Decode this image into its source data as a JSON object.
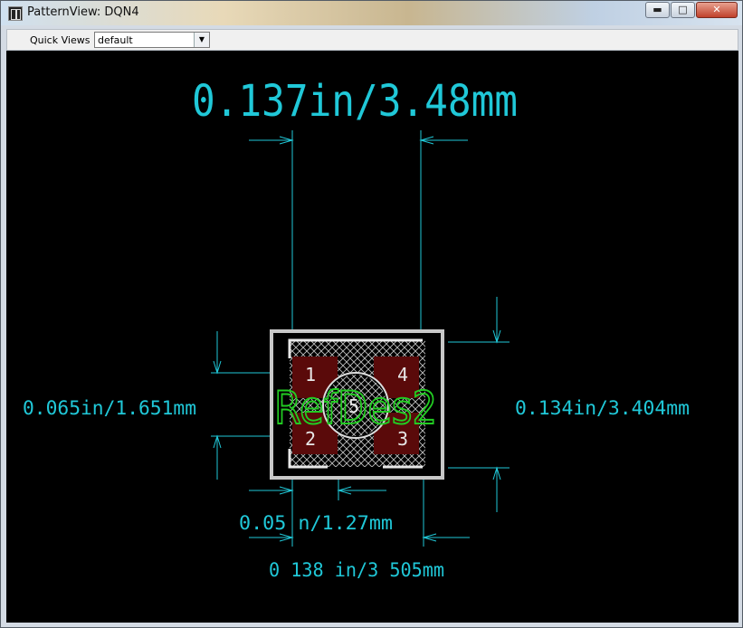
{
  "window": {
    "title": "PatternView: DQN4",
    "minimize": "▬",
    "maximize": "□",
    "close": "✕"
  },
  "toolbar": {
    "quick_views_label": "Quick Views :",
    "quick_views_value": "default"
  },
  "pattern": {
    "dim_top": "0.137in/3.48mm",
    "dim_left": "0.065in/1.651mm",
    "dim_right": "0.134in/3.404mm",
    "dim_pitch": "0.05 n/1.27mm",
    "dim_bottom": "0 138 in/3 505mm",
    "ref_des": "RefDes2",
    "pins": [
      "1",
      "2",
      "3",
      "4",
      "5"
    ]
  },
  "colors": {
    "dimension": "#20c8d8",
    "refdes": "#22cc22",
    "outline": "#d0d0d0",
    "pad": "#5a0a0a",
    "background": "#000000"
  }
}
